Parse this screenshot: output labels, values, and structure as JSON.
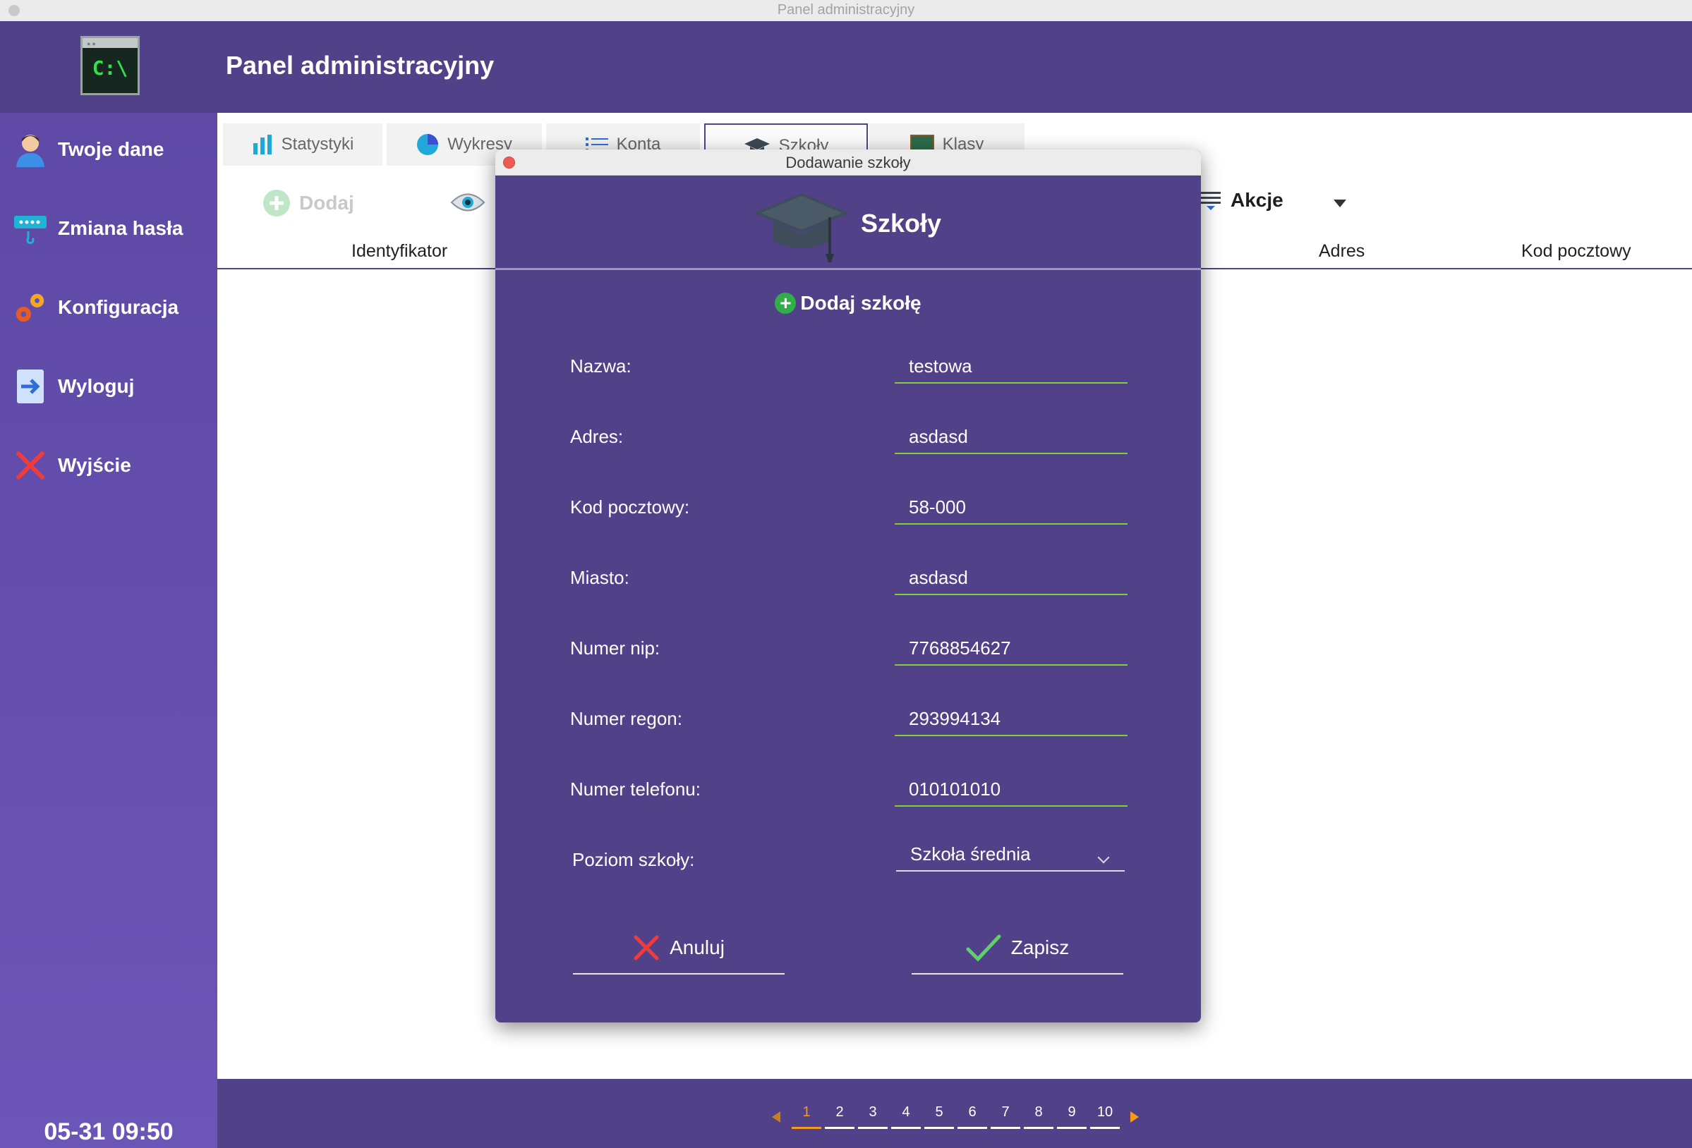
{
  "window": {
    "title": "Panel administracyjny"
  },
  "header": {
    "logo_text": "C:\\",
    "title": "Panel administracyjny"
  },
  "sidebar": {
    "items": [
      {
        "label": "Twoje dane",
        "icon": "user-icon"
      },
      {
        "label": "Zmiana hasła",
        "icon": "password-icon"
      },
      {
        "label": "Konfiguracja",
        "icon": "gears-icon"
      },
      {
        "label": "Wyloguj",
        "icon": "logout-icon"
      },
      {
        "label": "Wyjście",
        "icon": "exit-icon"
      }
    ],
    "clock": "05-31 09:50"
  },
  "tabs": [
    {
      "label": "Statystyki",
      "icon": "bar-chart-icon"
    },
    {
      "label": "Wykresy",
      "icon": "pie-chart-icon"
    },
    {
      "label": "Konta",
      "icon": "list-icon"
    },
    {
      "label": "Szkoły",
      "icon": "graduation-cap-icon",
      "active": true
    },
    {
      "label": "Klasy",
      "icon": "classroom-icon"
    }
  ],
  "toolbar": {
    "add_label": "Dodaj",
    "actions_label": "Akcje"
  },
  "table": {
    "columns": [
      "Identyfikator",
      "Adres",
      "Kod pocztowy"
    ]
  },
  "pagination": {
    "pages": [
      "1",
      "2",
      "3",
      "4",
      "5",
      "6",
      "7",
      "8",
      "9",
      "10"
    ],
    "current": "1"
  },
  "dialog": {
    "window_title": "Dodawanie szkoły",
    "heading": "Szkoły",
    "subtitle": "Dodaj szkołę",
    "fields": [
      {
        "label": "Nazwa:",
        "value": "testowa"
      },
      {
        "label": "Adres:",
        "value": "asdasd"
      },
      {
        "label": "Kod pocztowy:",
        "value": "58-000"
      },
      {
        "label": "Miasto:",
        "value": "asdasd"
      },
      {
        "label": "Numer nip:",
        "value": "7768854627"
      },
      {
        "label": "Numer regon:",
        "value": "293994134"
      },
      {
        "label": "Numer telefonu:",
        "value": "010101010"
      }
    ],
    "level": {
      "label": "Poziom szkoły:",
      "value": "Szkoła średnia"
    },
    "cancel_label": "Anuluj",
    "save_label": "Zapisz"
  },
  "colors": {
    "primary": "#514189",
    "sidebar": "#6350ae",
    "accent_green": "#7fd13b",
    "page_active": "#f59a1b",
    "close_red": "#ec5b54"
  }
}
